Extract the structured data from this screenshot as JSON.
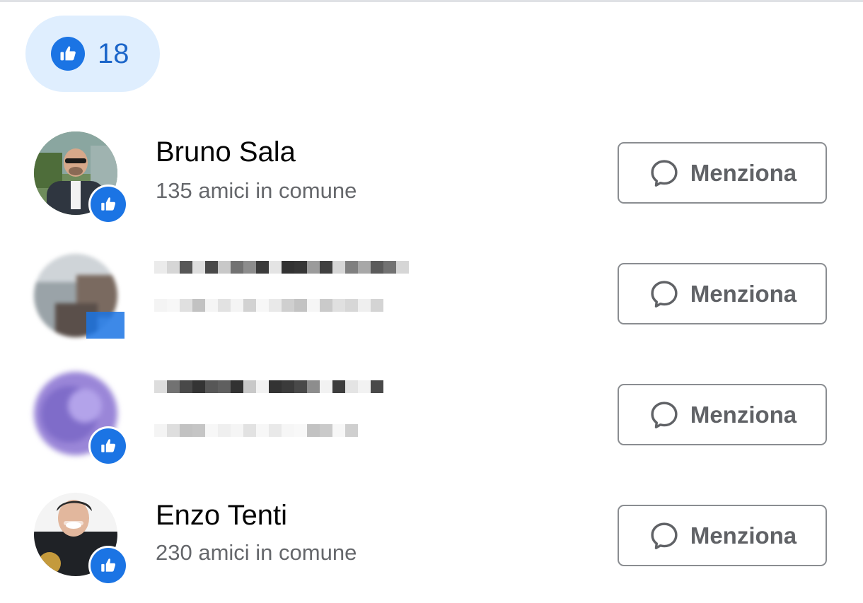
{
  "reactions": {
    "icon": "thumbs-up-icon",
    "count": "18",
    "accent_color": "#1b74e4"
  },
  "people": [
    {
      "name": "Bruno Sala",
      "mutual_friends": "135 amici in comune",
      "reaction_icon": "thumbs-up-icon",
      "action_label": "Menziona",
      "obscured": false
    },
    {
      "name": "",
      "mutual_friends": "",
      "reaction_icon": "thumbs-up-icon",
      "action_label": "Menziona",
      "obscured": true
    },
    {
      "name": "",
      "mutual_friends": "",
      "reaction_icon": "thumbs-up-icon",
      "action_label": "Menziona",
      "obscured": true
    },
    {
      "name": "Enzo Tenti",
      "mutual_friends": "230 amici in comune",
      "reaction_icon": "thumbs-up-icon",
      "action_label": "Menziona",
      "obscured": false
    }
  ]
}
